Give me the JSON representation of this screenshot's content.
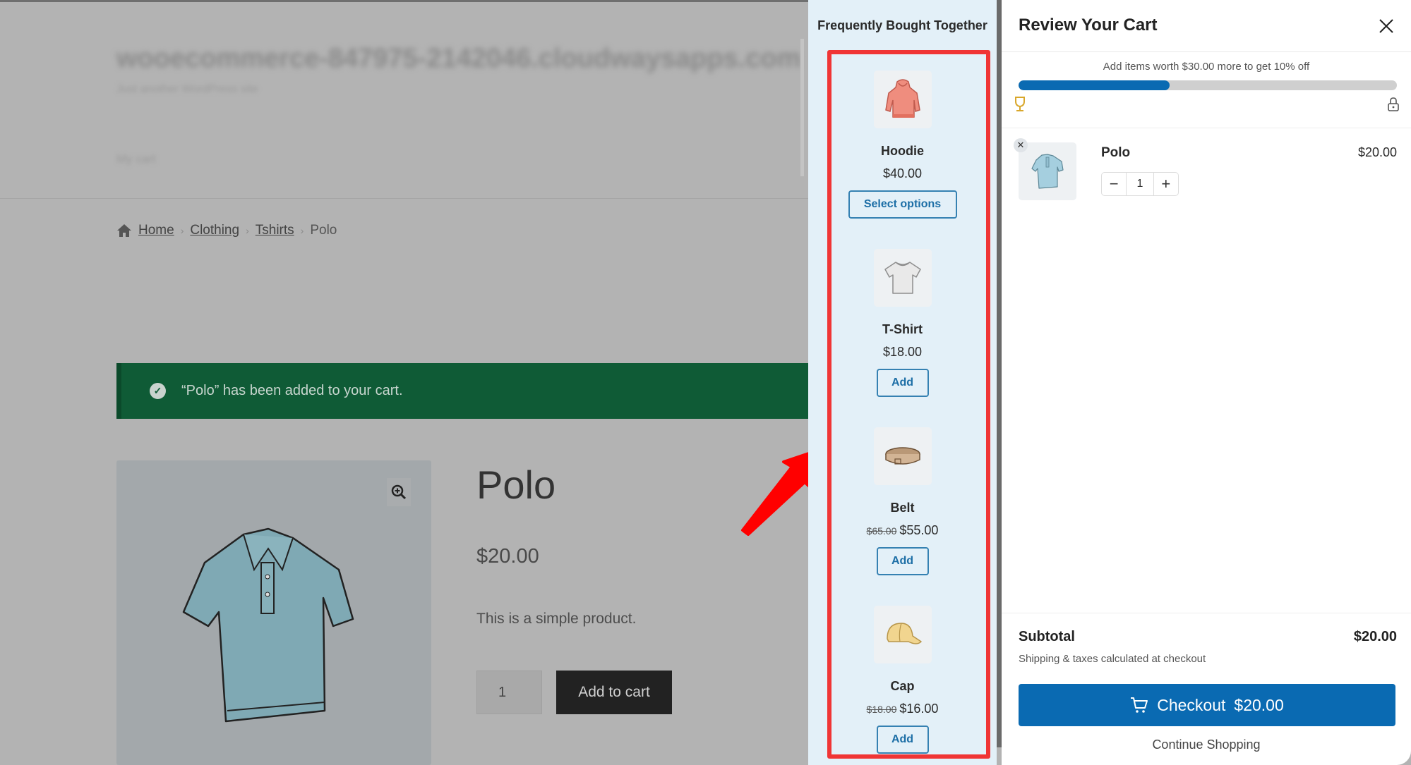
{
  "store": {
    "site_title": "wooecommerce-847975-2142046.cloudwaysapps.com",
    "site_tagline": "Just another WordPress site",
    "menu_item": "My cart",
    "breadcrumb": [
      "Home",
      "Clothing",
      "Tshirts",
      "Polo"
    ],
    "notice": "“Polo” has been added to your cart.",
    "product": {
      "title": "Polo",
      "price": "$20.00",
      "description": "This is a simple product.",
      "quantity": "1",
      "add_to_cart_label": "Add to cart"
    }
  },
  "fbt": {
    "title": "Frequently Bought Together",
    "highlight_color": "#f03535",
    "items": [
      {
        "name": "Hoodie",
        "old_price": "",
        "price": "$40.00",
        "button": "Select options",
        "icon": "hoodie-icon"
      },
      {
        "name": "T-Shirt",
        "old_price": "",
        "price": "$18.00",
        "button": "Add",
        "icon": "tshirt-icon"
      },
      {
        "name": "Belt",
        "old_price": "$65.00",
        "price": "$55.00",
        "button": "Add",
        "icon": "belt-icon"
      },
      {
        "name": "Cap",
        "old_price": "$18.00",
        "price": "$16.00",
        "button": "Add",
        "icon": "cap-icon"
      }
    ]
  },
  "cart": {
    "title": "Review Your Cart",
    "progress": {
      "message": "Add items worth $30.00 more to get 10% off",
      "percent": 40,
      "color": "#0a6ab2"
    },
    "items": [
      {
        "name": "Polo",
        "price": "$20.00",
        "quantity": "1"
      }
    ],
    "subtotal_label": "Subtotal",
    "subtotal_value": "$20.00",
    "shipping_note": "Shipping & taxes calculated at checkout",
    "checkout_label": "Checkout",
    "checkout_amount": "$20.00",
    "continue_label": "Continue Shopping"
  }
}
